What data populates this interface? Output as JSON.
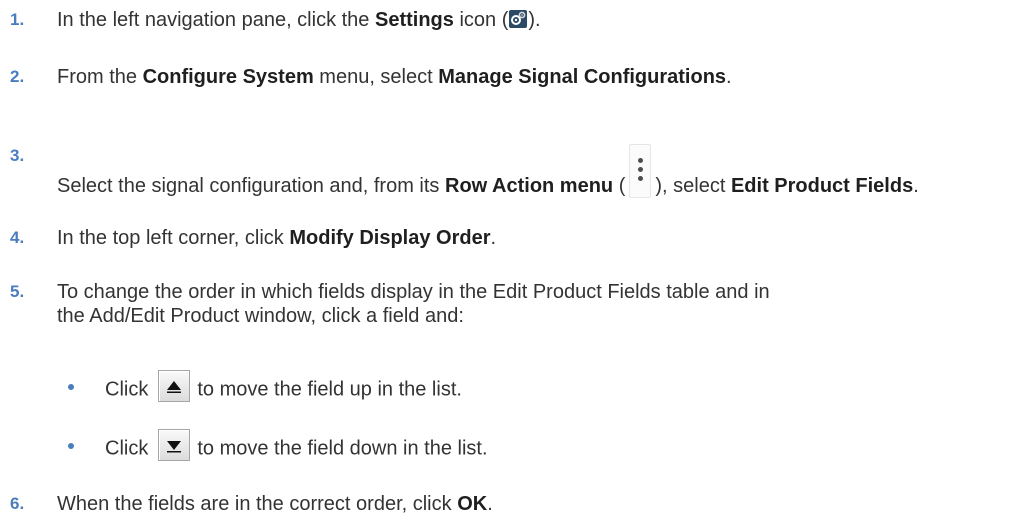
{
  "steps": [
    {
      "number": "1.",
      "pre": "In the left navigation pane, click the ",
      "bold1": "Settings",
      "mid1": " icon (",
      "post": ")."
    },
    {
      "number": "2.",
      "pre": "From the ",
      "bold1": "Configure System",
      "mid1": " menu, select ",
      "bold2": "Manage Signal Configurations",
      "post": "."
    },
    {
      "number": "3.",
      "pre": "Select the signal configuration and, from its ",
      "bold1": "Row Action menu",
      "mid1": " (",
      "mid2": "), select ",
      "bold2": "Edit Product Fields",
      "post": "."
    },
    {
      "number": "4.",
      "pre": "In the top left corner, click ",
      "bold1": "Modify Display Order",
      "post": "."
    },
    {
      "number": "5.",
      "line1": "To change the order in which fields display in the Edit Product Fields table and in",
      "line2": "the Add/Edit Product window, click a field and:"
    },
    {
      "number": "6.",
      "pre": "When the fields are in the correct order, click ",
      "bold1": "OK",
      "post": "."
    }
  ],
  "bullets": [
    {
      "pre": "Click",
      "post": "to move the field up in the list.",
      "icon": "arrow-up-icon"
    },
    {
      "pre": "Click",
      "post": "to move the field down in the list.",
      "icon": "arrow-down-icon"
    }
  ],
  "icons": {
    "settings": "settings-gear-icon",
    "row_action": "kebab-menu-icon"
  },
  "colors": {
    "step_number": "#4a7dbd",
    "text": "#333333",
    "settings_icon_bg": "#2a4a66"
  }
}
